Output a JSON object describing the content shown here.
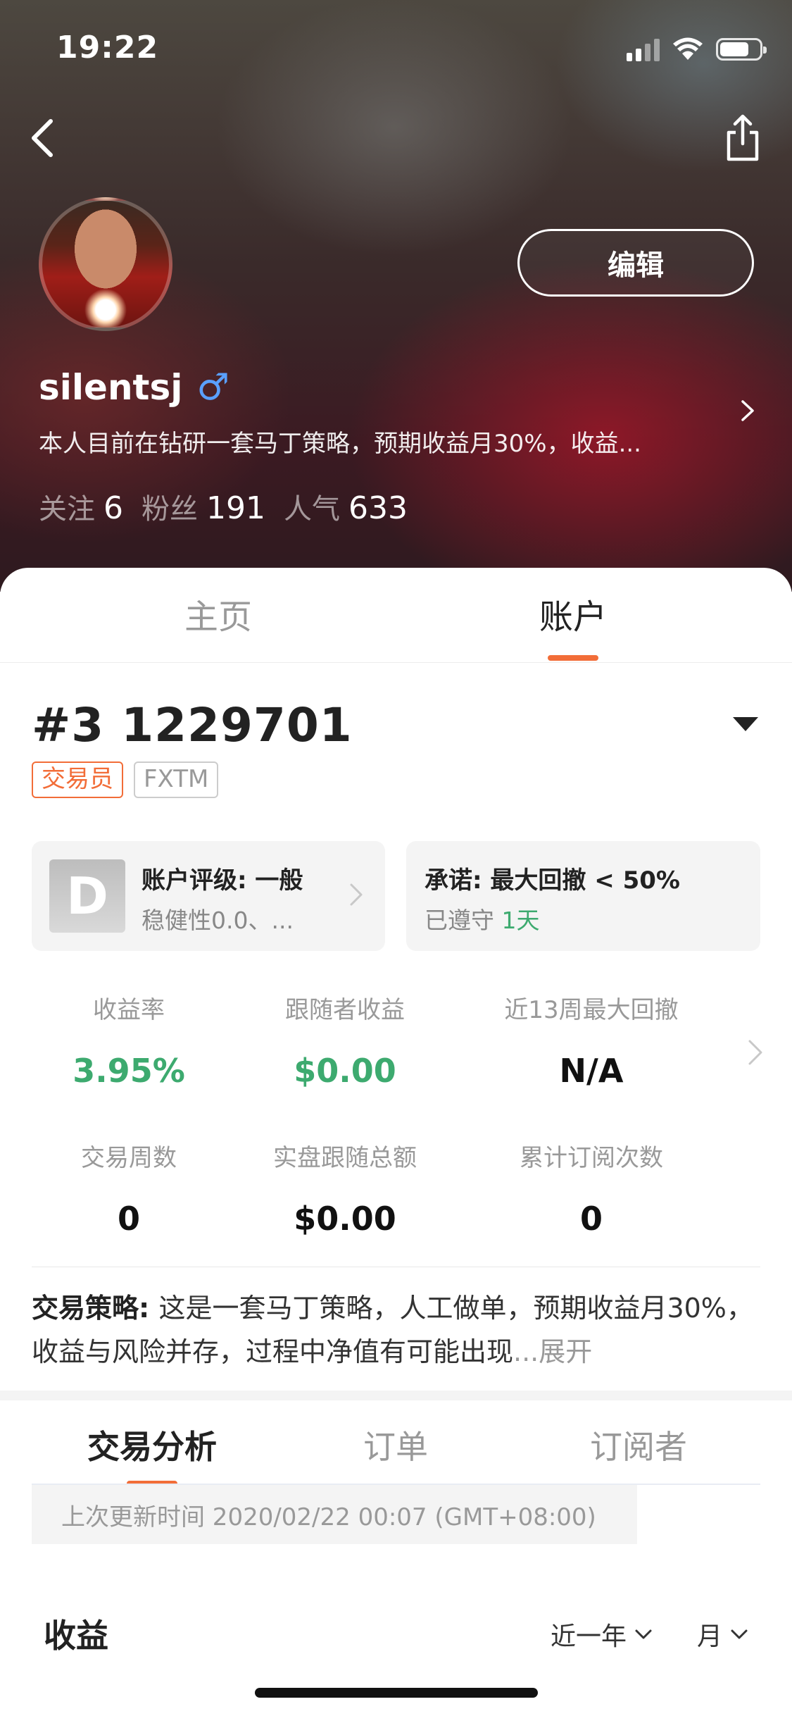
{
  "status_bar": {
    "time": "19:22"
  },
  "profile": {
    "username": "silentsj",
    "gender_symbol": "♂",
    "bio": "本人目前在钻研一套马丁策略，预期收益月30%，收益...",
    "edit_label": "编辑",
    "stats": {
      "following_label": "关注",
      "following": "6",
      "fans_label": "粉丝",
      "fans": "191",
      "popularity_label": "人气",
      "popularity": "633"
    }
  },
  "main_tabs": [
    {
      "label": "主页"
    },
    {
      "label": "账户"
    }
  ],
  "account": {
    "number": "#3 1229701",
    "tags": [
      "交易员",
      "FXTM"
    ],
    "rating_card": {
      "grade": "D",
      "title": "账户评级: 一般",
      "subtitle": "稳健性0.0、..."
    },
    "promise_card": {
      "title": "承诺: 最大回撤 < 50%",
      "subtitle_prefix": "已遵守 ",
      "subtitle_value": "1天"
    },
    "metrics": [
      {
        "label": "收益率",
        "value": "3.95%"
      },
      {
        "label": "跟随者收益",
        "value": "$0.00"
      },
      {
        "label": "近13周最大回撤",
        "value": "N/A"
      },
      {
        "label": "交易周数",
        "value": "0"
      },
      {
        "label": "实盘跟随总额",
        "value": "$0.00"
      },
      {
        "label": "累计订阅次数",
        "value": "0"
      }
    ],
    "strategy": {
      "label": "交易策略: ",
      "text": "这是一套马丁策略，人工做单，预期收益月30%，收益与风险并存，过程中净值有可能出现",
      "more": "...展开"
    }
  },
  "sub_tabs": [
    {
      "label": "交易分析"
    },
    {
      "label": "订单"
    },
    {
      "label": "订阅者"
    }
  ],
  "update_info": "上次更新时间 2020/02/22 00:07 (GMT+08:00)",
  "earnings": {
    "title": "收益",
    "range_filter": "近一年",
    "period_filter": "月"
  },
  "colors": {
    "accent": "#f26d38",
    "positive": "#3daa6f"
  },
  "icons": {
    "back": "chevron-left-icon",
    "share": "share-icon",
    "dropdown": "triangle-down-icon"
  }
}
